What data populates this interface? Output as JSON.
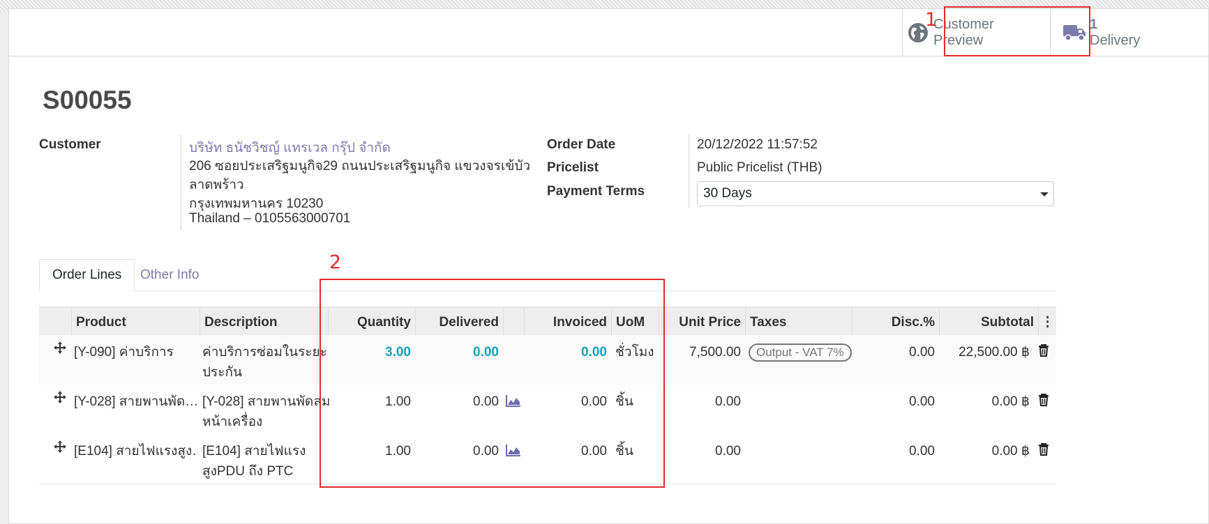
{
  "statbuttons": {
    "preview": {
      "line1": "Customer",
      "line2": "Preview"
    },
    "delivery": {
      "count": "1",
      "label": "Delivery"
    }
  },
  "annotations": {
    "first": "1",
    "second": "2"
  },
  "order": {
    "title": "S00055",
    "customer_label": "Customer",
    "customer_name": "บริษัท ธนัชวิชญ์ แทรเวล กรุ๊ป จำกัด",
    "address_line1": "206 ซอยประเสริฐมนูกิจ29 ถนนประเสริฐมนูกิจ แขวงจรเข้บัว",
    "address_line2": "ลาดพร้าว",
    "address_line3": "กรุงเทพมหานคร 10230",
    "address_line4": "Thailand – 0105563000701",
    "order_date_label": "Order Date",
    "order_date": "20/12/2022 11:57:52",
    "pricelist_label": "Pricelist",
    "pricelist": "Public Pricelist (THB)",
    "payment_terms_label": "Payment Terms",
    "payment_terms": "30 Days"
  },
  "tabs": {
    "order_lines": "Order Lines",
    "other_info": "Other Info"
  },
  "table": {
    "headers": {
      "product": "Product",
      "description": "Description",
      "quantity": "Quantity",
      "delivered": "Delivered",
      "invoiced": "Invoiced",
      "uom": "UoM",
      "unit_price": "Unit Price",
      "taxes": "Taxes",
      "disc": "Disc.%",
      "subtotal": "Subtotal",
      "menu": "⋮"
    },
    "rows": [
      {
        "product": "[Y-090] ค่าบริการ",
        "desc1": "ค่าบริการซ่อมในระยะ",
        "desc2": "ประกัน",
        "qty": "3.00",
        "delivered": "0.00",
        "invoiced": "0.00",
        "uom": "ชั่วโมง",
        "price": "7,500.00",
        "tax": "Output - VAT 7%",
        "disc": "0.00",
        "subtotal": "22,500.00 ฿"
      },
      {
        "product": "[Y-028] สายพานพัด…",
        "desc1": "[Y-028] สายพานพัดลม",
        "desc2": "หน้าเครื่อง",
        "qty": "1.00",
        "delivered": "0.00",
        "invoiced": "0.00",
        "uom": "ชิ้น",
        "price": "0.00",
        "tax": "",
        "disc": "0.00",
        "subtotal": "0.00 ฿"
      },
      {
        "product": "[E104] สายไฟแรงสูง…",
        "desc1": "[E104] สายไฟแรง",
        "desc2": "สูงPDU ถึง PTC",
        "qty": "1.00",
        "delivered": "0.00",
        "invoiced": "0.00",
        "uom": "ชิ้น",
        "price": "0.00",
        "tax": "",
        "disc": "0.00",
        "subtotal": "0.00 ฿"
      }
    ]
  },
  "icons": {
    "preview": "globe-icon",
    "delivery": "truck-icon",
    "move": "drag-handle-icon",
    "forecast": "area-chart-icon",
    "delete": "trash-icon"
  },
  "colors": {
    "link": "#7c7bad",
    "teal": "#17a2b8",
    "annotation": "#e32b2b"
  }
}
